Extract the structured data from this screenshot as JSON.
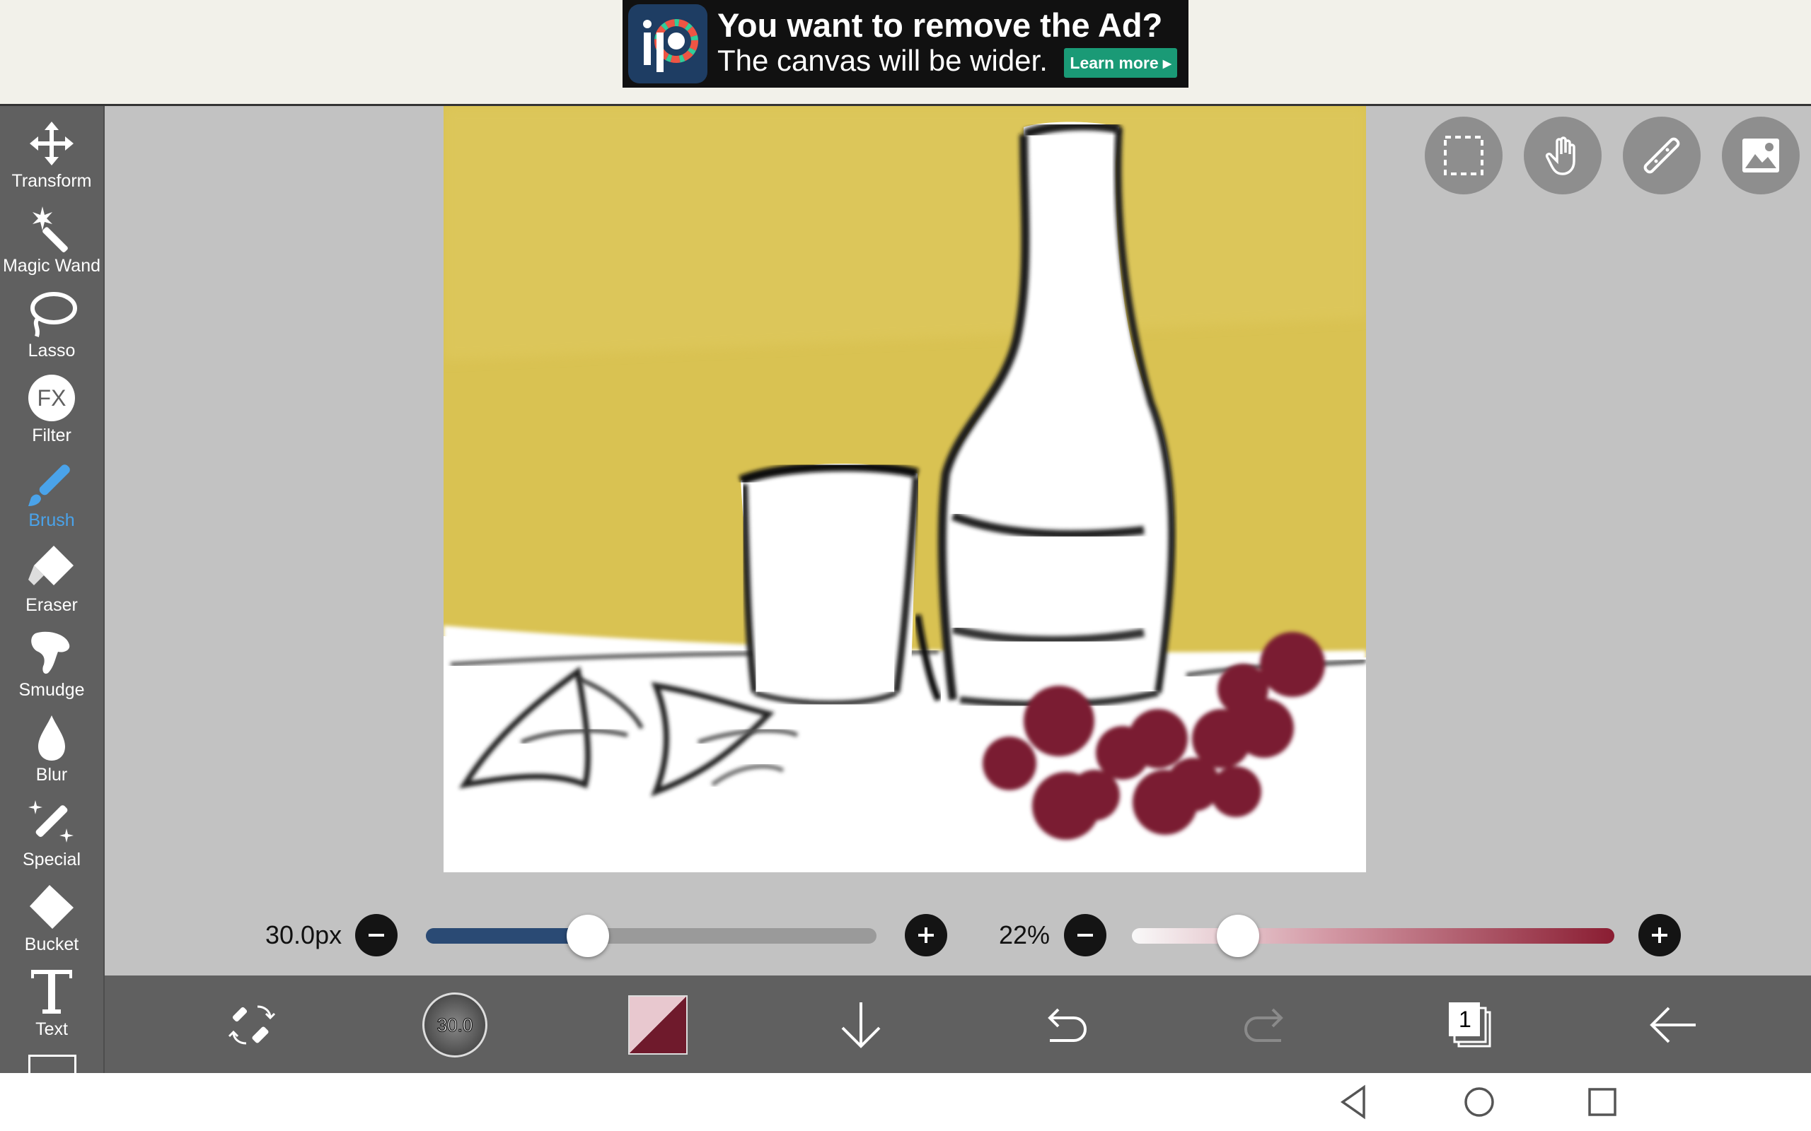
{
  "ad": {
    "headline": "You want to remove the Ad?",
    "subline": "The canvas will be wider.",
    "cta": "Learn more ▸",
    "logo_letters": "iP"
  },
  "tools": [
    {
      "label": "Transform",
      "icon": "move-arrows-icon",
      "active": false
    },
    {
      "label": "Magic Wand",
      "icon": "magic-wand-icon",
      "active": false
    },
    {
      "label": "Lasso",
      "icon": "lasso-icon",
      "active": false
    },
    {
      "label": "Filter",
      "icon": "fx-icon",
      "active": false
    },
    {
      "label": "Brush",
      "icon": "brush-icon",
      "active": true
    },
    {
      "label": "Eraser",
      "icon": "eraser-icon",
      "active": false
    },
    {
      "label": "Smudge",
      "icon": "smudge-finger-icon",
      "active": false
    },
    {
      "label": "Blur",
      "icon": "droplet-icon",
      "active": false
    },
    {
      "label": "Special",
      "icon": "sparkle-pen-icon",
      "active": false
    },
    {
      "label": "Bucket",
      "icon": "bucket-icon",
      "active": false
    },
    {
      "label": "Text",
      "icon": "text-t-icon",
      "active": false
    }
  ],
  "canvas_tools": [
    {
      "name": "selection-icon"
    },
    {
      "name": "hand-touch-icon"
    },
    {
      "name": "ruler-icon"
    },
    {
      "name": "image-icon"
    }
  ],
  "sliders": {
    "brush_size": {
      "label": "30.0px",
      "value_fraction": 0.36,
      "color": "#2a4a74"
    },
    "opacity": {
      "label": "22%",
      "value_fraction": 0.22,
      "color": "#8a1d32"
    }
  },
  "bottom_bar": {
    "brush_preview_label": "30.0",
    "layer_count": "1",
    "primary_color": "#6f1a2c",
    "icons": [
      "swap-tool-icon",
      "brush-preview",
      "color-swatch",
      "download-arrow-icon",
      "undo-icon",
      "redo-icon",
      "layers-icon",
      "back-arrow-icon"
    ]
  },
  "colors": {
    "accent_blue": "#4aa3ea",
    "toolbar_bg": "#606060",
    "workspace_bg": "#c2c2c2",
    "canvas_bg_yellow": "#d9c252",
    "grape": "#7a1f33"
  }
}
